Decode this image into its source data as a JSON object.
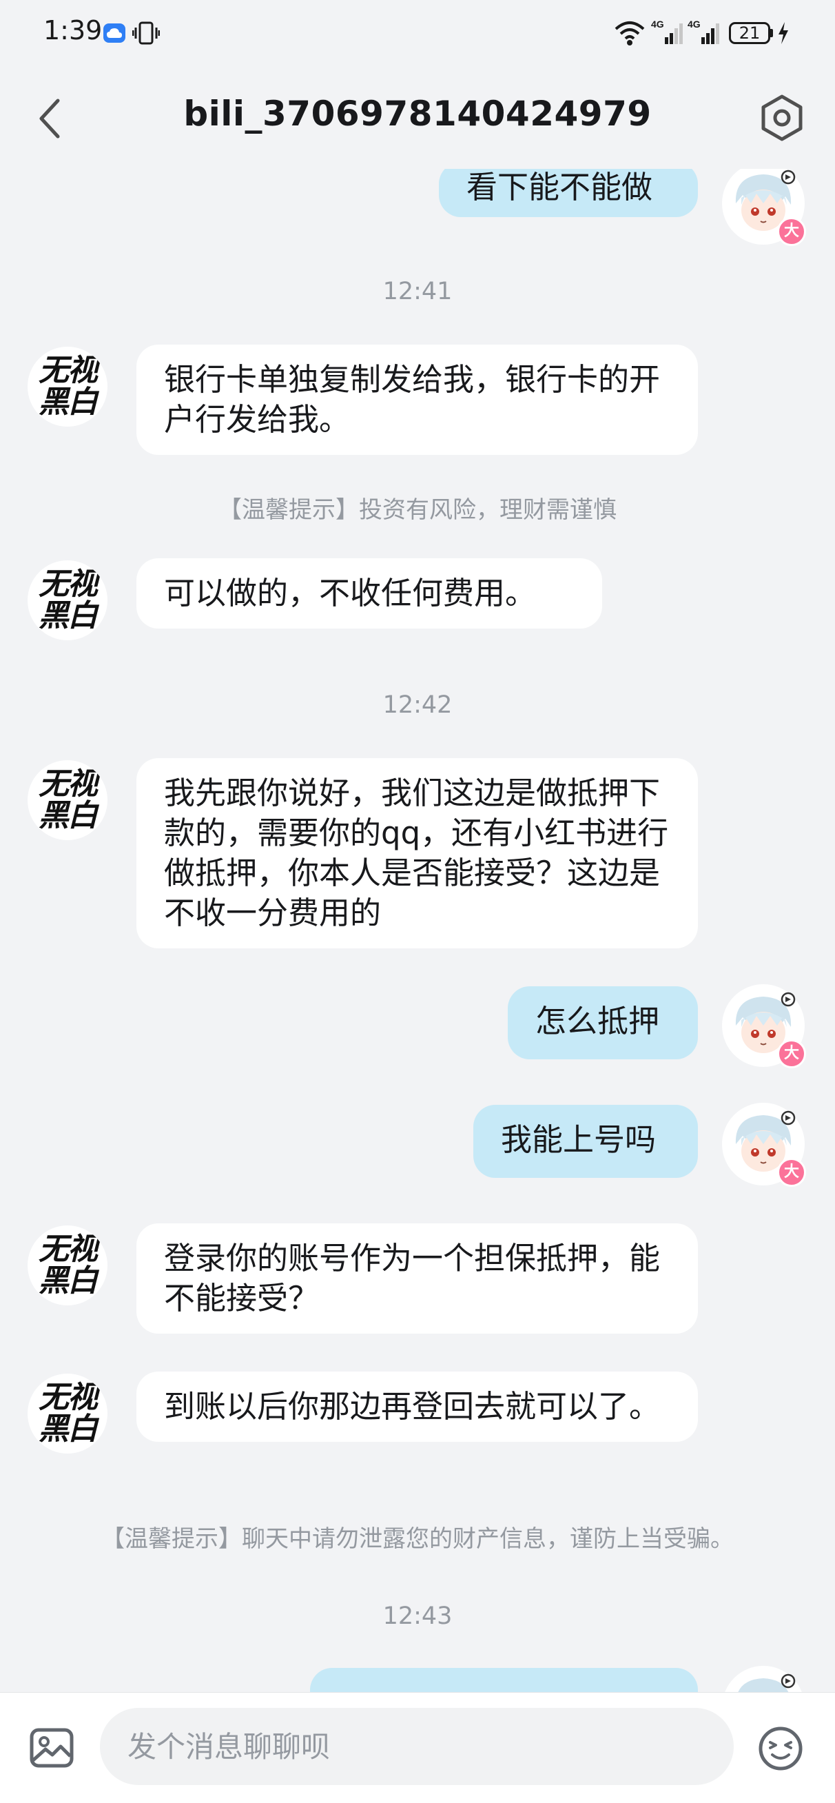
{
  "status_bar": {
    "time": "1:39",
    "battery": "21",
    "network_labels": [
      "4G",
      "4G"
    ]
  },
  "header": {
    "title": "bili_3706978140424979",
    "back_icon": "chevron-left-icon",
    "settings_icon": "hexagon-settings-icon"
  },
  "messages": [
    {
      "side": "right",
      "text": "看下能不能做"
    },
    {
      "type": "timestamp",
      "text": "12:41"
    },
    {
      "side": "left",
      "sender_avatar_text": "无视黑白",
      "text": "银行卡单独复制发给我，银行卡的开户行发给我。"
    },
    {
      "type": "tip",
      "text": "【温馨提示】投资有风险，理财需谨慎"
    },
    {
      "side": "left",
      "sender_avatar_text": "无视黑白",
      "text": "可以做的，不收任何费用。"
    },
    {
      "type": "timestamp",
      "text": "12:42"
    },
    {
      "side": "left",
      "sender_avatar_text": "无视黑白",
      "text": "我先跟你说好，我们这边是做抵押下款的，需要你的qq，还有小红书进行做抵押，你本人是否能接受？这边是不收一分费用的"
    },
    {
      "side": "right",
      "text": "怎么抵押"
    },
    {
      "side": "right",
      "text": "我能上号吗"
    },
    {
      "side": "left",
      "sender_avatar_text": "无视黑白",
      "text": "登录你的账号作为一个担保抵押，能不能接受？"
    },
    {
      "side": "left",
      "sender_avatar_text": "无视黑白",
      "text": "到账以后你那边再登回去就可以了。"
    },
    {
      "type": "tip",
      "text": "【温馨提示】聊天中请勿泄露您的财产信息，谨防上当受骗。"
    },
    {
      "type": "timestamp",
      "text": "12:43"
    }
  ],
  "avatar_left": {
    "line1": "无视",
    "line2": "黑白"
  },
  "avatar_badge": "大",
  "input": {
    "placeholder": "发个消息聊聊呗"
  },
  "colors": {
    "background": "#f2f3f5",
    "bubble_left": "#ffffff",
    "bubble_right": "#c6e9f7",
    "muted_text": "#9499a0",
    "badge_pink": "#fb7299"
  }
}
